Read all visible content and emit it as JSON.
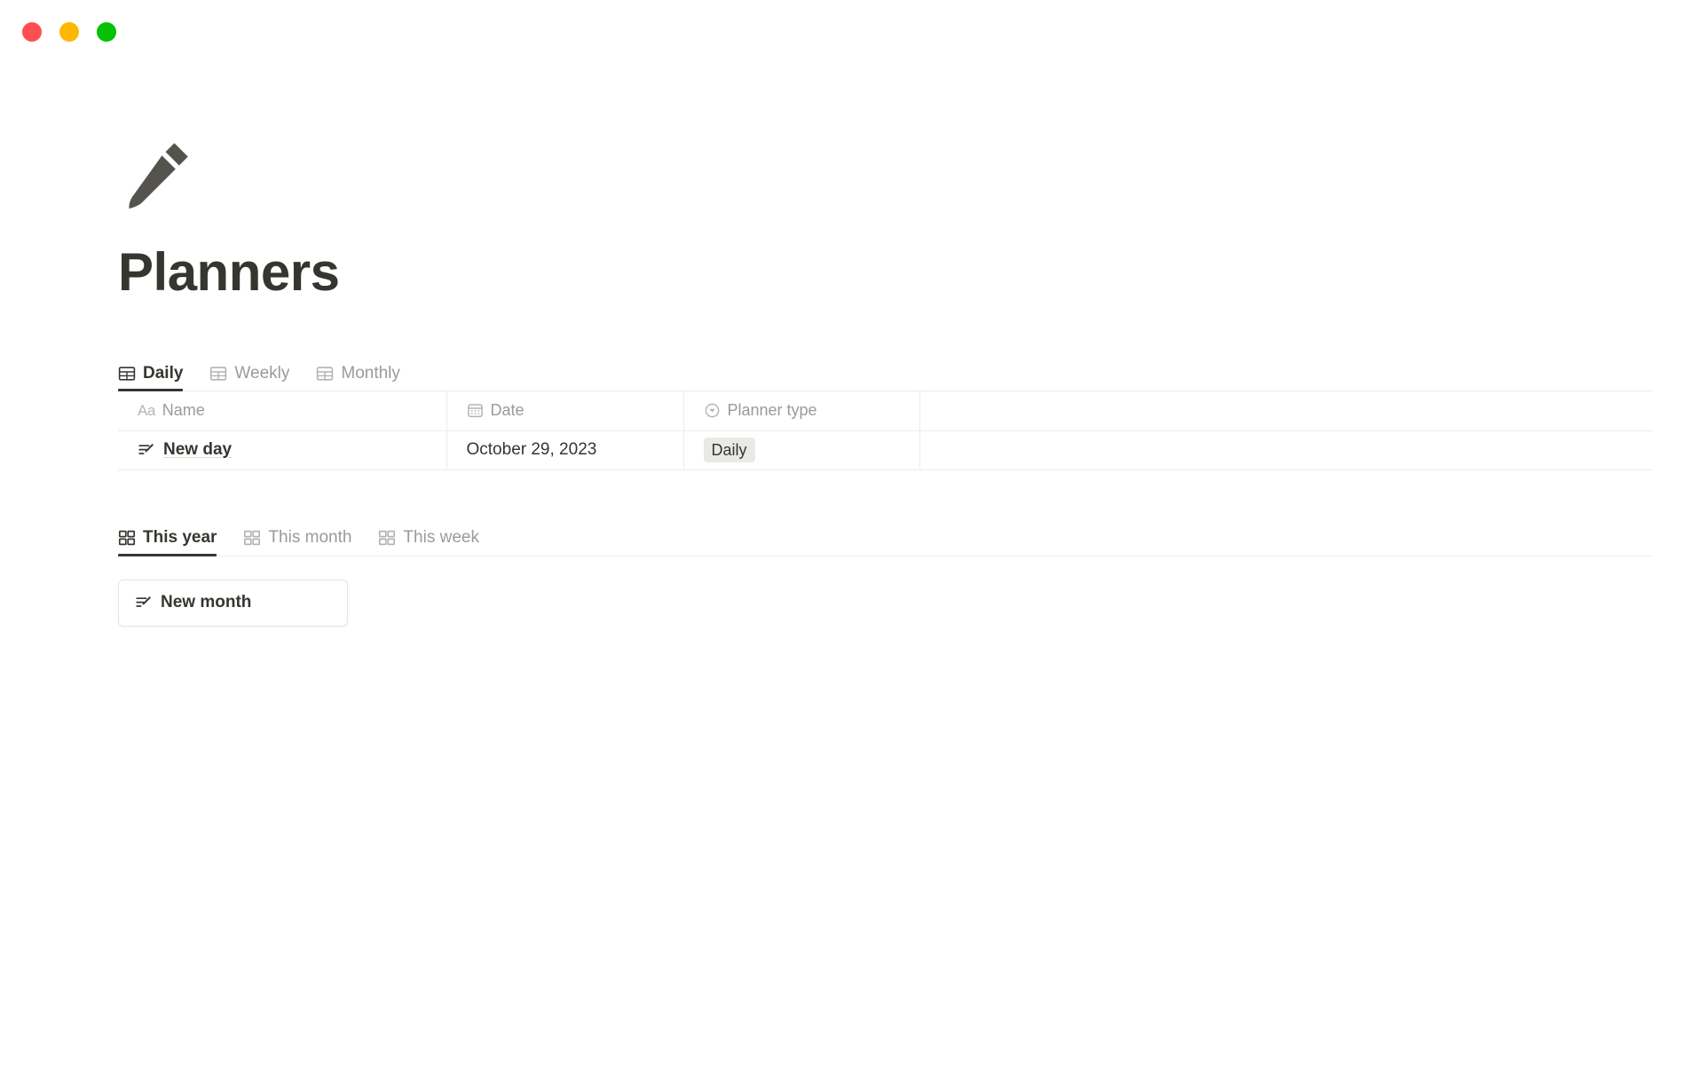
{
  "window": {
    "traffic_lights": [
      {
        "name": "close",
        "color": "#ff4f4f",
        "label": "Close"
      },
      {
        "name": "minimize",
        "color": "#ffb600",
        "label": "Minimize"
      },
      {
        "name": "maximize",
        "color": "#03c103",
        "label": "Maximize"
      }
    ]
  },
  "page": {
    "icon": "pencil-icon",
    "title": "Planners"
  },
  "database_view": {
    "tabs": [
      {
        "label": "Daily",
        "icon": "table-icon",
        "active": true
      },
      {
        "label": "Weekly",
        "icon": "table-icon",
        "active": false
      },
      {
        "label": "Monthly",
        "icon": "table-icon",
        "active": false
      }
    ],
    "columns": [
      {
        "label": "Name",
        "icon": "text-type-icon"
      },
      {
        "label": "Date",
        "icon": "calendar-icon"
      },
      {
        "label": "Planner type",
        "icon": "select-icon"
      },
      {
        "label": "",
        "icon": ""
      }
    ],
    "rows": [
      {
        "name": "New day",
        "name_icon": "note-pencil-icon",
        "date": "October 29, 2023",
        "planner_type": "Daily"
      }
    ]
  },
  "gallery_view": {
    "tabs": [
      {
        "label": "This year",
        "icon": "gallery-icon",
        "active": true
      },
      {
        "label": "This month",
        "icon": "gallery-icon",
        "active": false
      },
      {
        "label": "This week",
        "icon": "gallery-icon",
        "active": false
      }
    ],
    "cards": [
      {
        "title": "New month",
        "icon": "note-pencil-icon"
      }
    ]
  },
  "colors": {
    "text_primary": "#37352f",
    "text_muted": "#9b9a97",
    "border": "#ececeb",
    "tag_background": "#e9e9e7"
  }
}
